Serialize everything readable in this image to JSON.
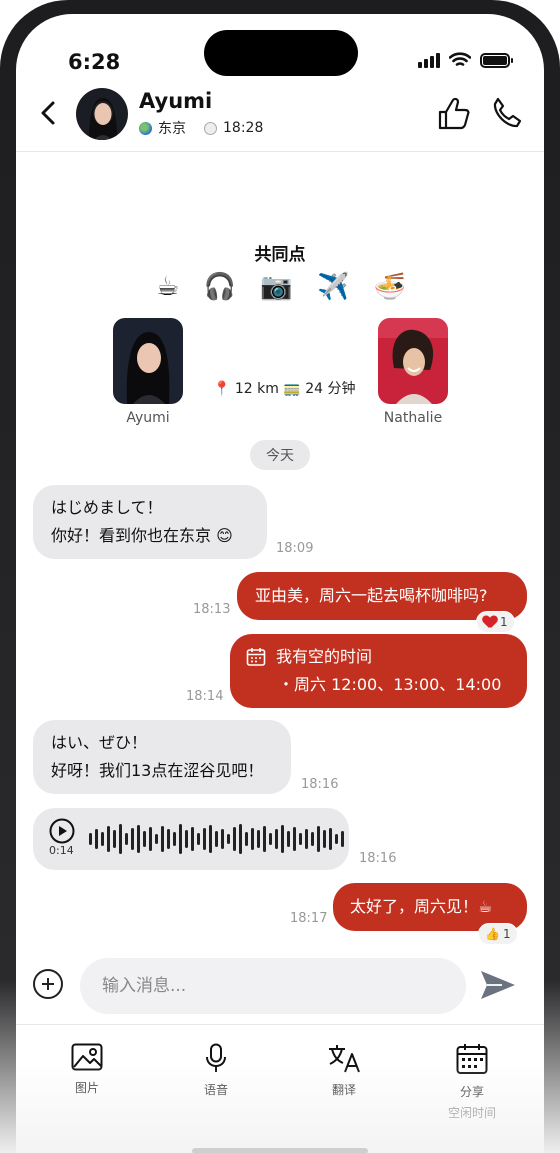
{
  "status_bar": {
    "time": "6:28"
  },
  "header": {
    "contact_name": "Ayumi",
    "location": "东京",
    "local_time": "18:28"
  },
  "common": {
    "title": "共同点",
    "interests": [
      "☕",
      "🎧",
      "📷",
      "✈️",
      "🍜"
    ]
  },
  "profiles": {
    "left_name": "Ayumi",
    "right_name": "Nathalie",
    "distance": "📍 12 km 🚃 24 分钟"
  },
  "date_chip": "今天",
  "messages": [
    {
      "id": "m1",
      "lines": [
        "はじめまして！",
        "你好！看到你也在东京 😊"
      ],
      "time": "18:09"
    },
    {
      "id": "m2",
      "text": "亚由美，周六一起去喝杯咖啡吗?",
      "time": "18:13",
      "reaction_count": "1"
    },
    {
      "id": "m3",
      "title": "我有空的时间",
      "detail": "・周六 12:00、13:00、14:00",
      "time": "18:14"
    },
    {
      "id": "m4",
      "lines": [
        "はい、ぜひ！",
        "好呀！我们13点在涩谷见吧！"
      ],
      "time": "18:16"
    },
    {
      "id": "m5",
      "voice_duration": "0:14",
      "time": "18:16"
    },
    {
      "id": "m6",
      "text": "太好了，周六见！☕",
      "time": "18:17",
      "reaction_emoji": "👍",
      "reaction_count": "1"
    }
  ],
  "composer": {
    "placeholder": "输入消息..."
  },
  "toolbar": {
    "photo": "图片",
    "voice": "语音",
    "translate": "翻译",
    "share": "分享",
    "share_sub": "空闲时间"
  },
  "colors": {
    "accent": "#c2301f",
    "incoming_bubble": "#e9e9ec"
  }
}
